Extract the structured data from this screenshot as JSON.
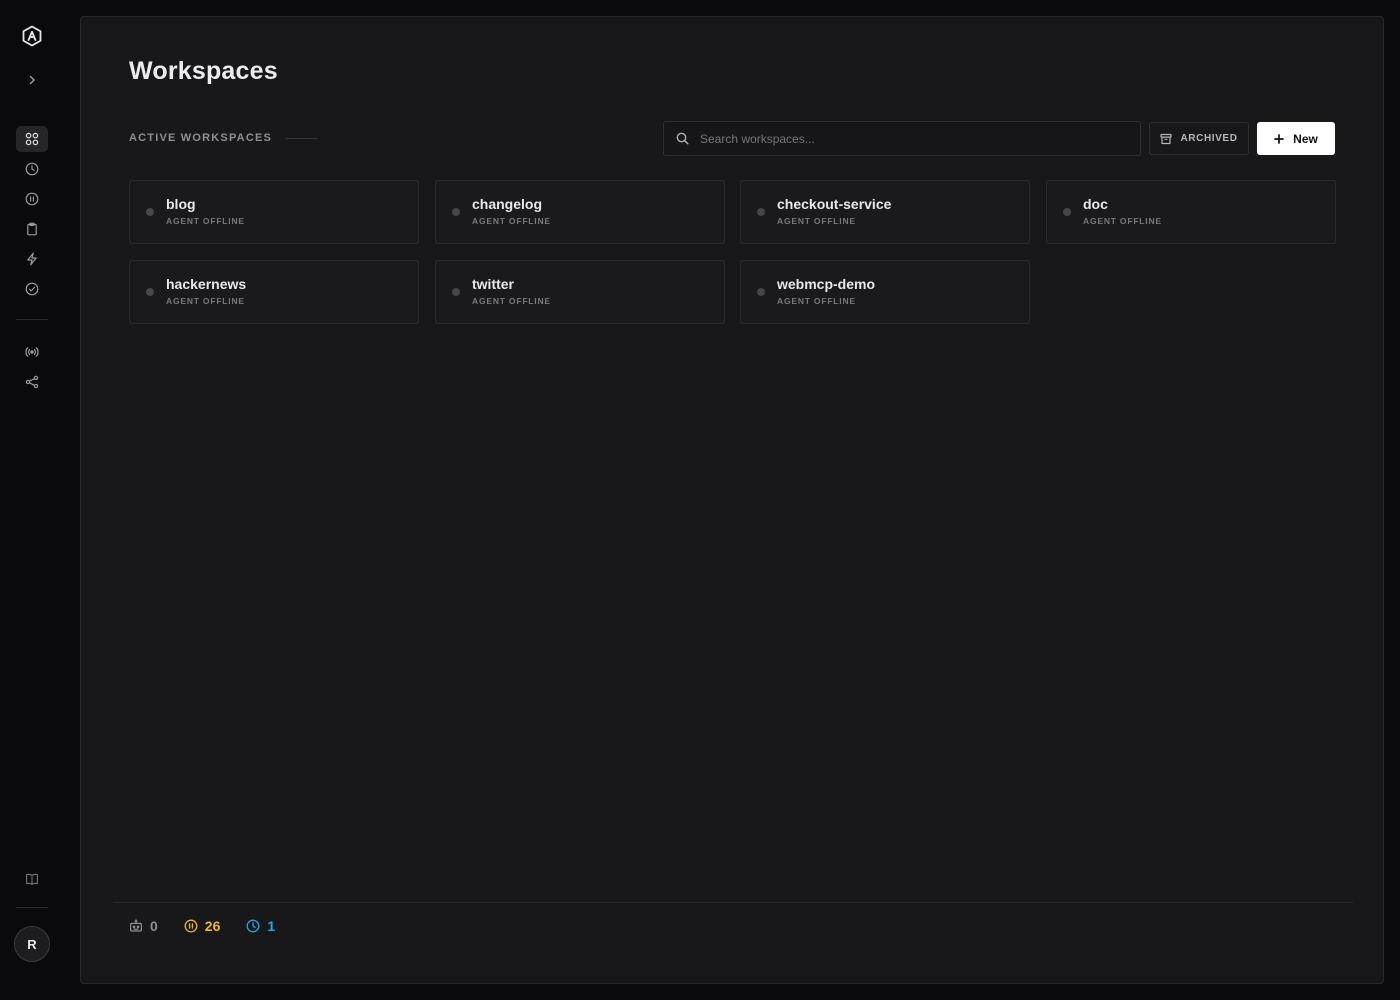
{
  "colors": {
    "accent_amber": "#f0b429",
    "accent_blue": "#1ea7e8",
    "muted": "#8e8e95",
    "primary_button_bg": "#ffffff"
  },
  "sidebar": {
    "items": [
      {
        "icon": "grid-icon",
        "active": true
      },
      {
        "icon": "clock-icon",
        "active": false
      },
      {
        "icon": "pause-circle-icon",
        "active": false
      },
      {
        "icon": "clipboard-icon",
        "active": false
      },
      {
        "icon": "lightning-icon",
        "active": false
      },
      {
        "icon": "check-circle-icon",
        "active": false
      },
      {
        "icon": "broadcast-icon",
        "active": false
      },
      {
        "icon": "share-icon",
        "active": false
      }
    ],
    "bottom_icon": "book-icon",
    "avatar_initial": "R"
  },
  "header": {
    "title": "Workspaces"
  },
  "toolbar": {
    "section_label": "ACTIVE WORKSPACES",
    "search_placeholder": "Search workspaces...",
    "archived_label": "ARCHIVED",
    "new_label": "New"
  },
  "workspaces": [
    {
      "name": "blog",
      "status": "AGENT OFFLINE"
    },
    {
      "name": "changelog",
      "status": "AGENT OFFLINE"
    },
    {
      "name": "checkout-service",
      "status": "AGENT OFFLINE"
    },
    {
      "name": "doc",
      "status": "AGENT OFFLINE"
    },
    {
      "name": "hackernews",
      "status": "AGENT OFFLINE"
    },
    {
      "name": "twitter",
      "status": "AGENT OFFLINE"
    },
    {
      "name": "webmcp-demo",
      "status": "AGENT OFFLINE"
    }
  ],
  "footer": {
    "stats": [
      {
        "icon": "robot-icon",
        "value": "0",
        "color": "#8e8e95"
      },
      {
        "icon": "pause-circle-icon",
        "value": "26",
        "color": "#f0b429"
      },
      {
        "icon": "clock-icon",
        "value": "1",
        "color": "#1ea7e8"
      }
    ]
  }
}
